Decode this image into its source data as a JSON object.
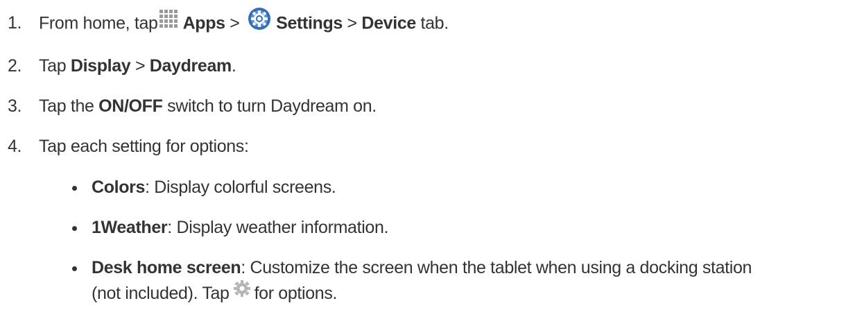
{
  "steps": [
    {
      "num": "1.",
      "pre": "From home, tap",
      "apps_icon": "apps-grid-icon",
      "apps": "Apps",
      "sep1": " > ",
      "settings_icon": "settings-gear-icon",
      "settings": "Settings",
      "sep2": " > ",
      "device": "Device",
      "post": " tab."
    },
    {
      "num": "2.",
      "pre": "Tap ",
      "display": "Display",
      "sep": " > ",
      "daydream": "Daydream",
      "post": "."
    },
    {
      "num": "3.",
      "pre": "Tap the ",
      "onoff": "ON/OFF",
      "post": " switch to turn Daydream on."
    },
    {
      "num": "4.",
      "text": "Tap each setting for options:"
    }
  ],
  "options": [
    {
      "label": "Colors",
      "desc": ": Display colorful screens."
    },
    {
      "label": "1Weather",
      "desc": ": Display weather information."
    },
    {
      "label": "Desk home screen",
      "desc": ": Customize the screen when the tablet when using a docking station",
      "desc2_pre": "(not included). Tap",
      "icon": "gear-icon",
      "desc2_post": "for options."
    }
  ],
  "colors": {
    "text": "#333333",
    "settings_blue": "#2f6fc1",
    "gear_gray": "#b5b5b5",
    "apps_gray": "#9a9a9a"
  }
}
